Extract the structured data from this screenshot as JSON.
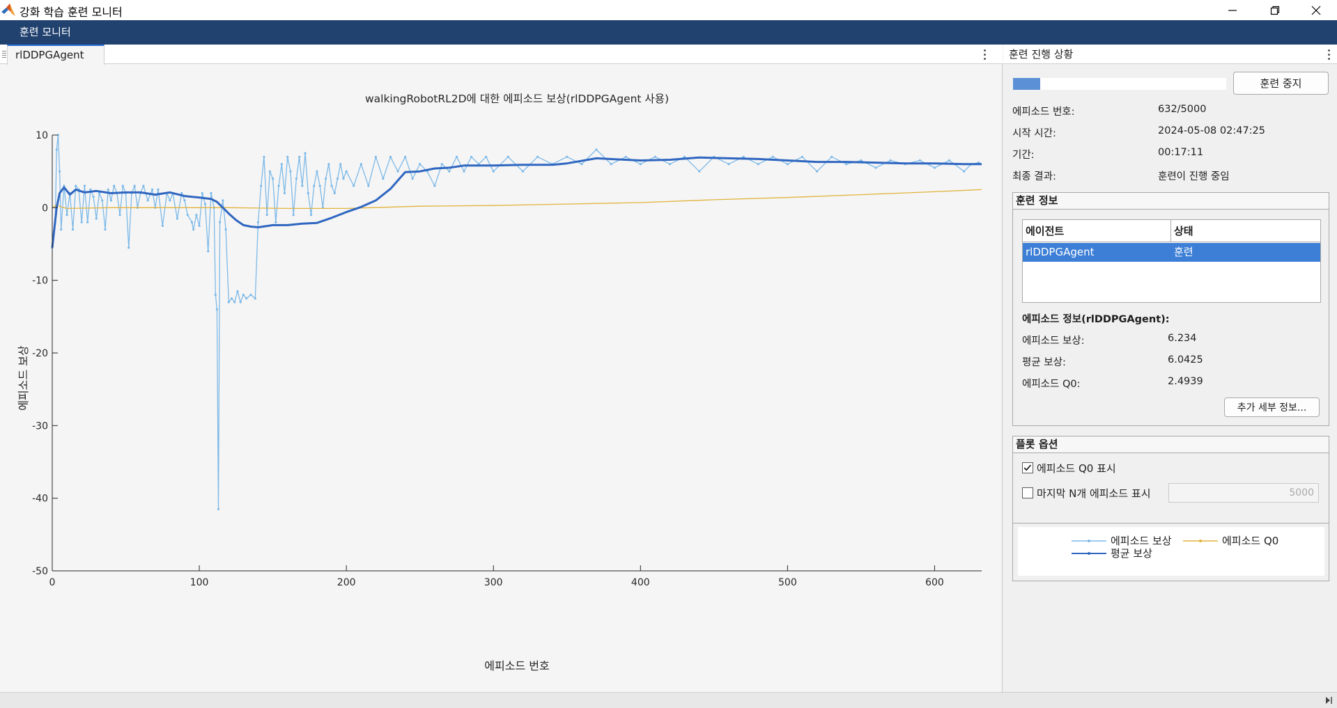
{
  "window": {
    "title": "강화 학습 훈련 모니터",
    "app_tab": "훈련 모니터"
  },
  "document": {
    "tab_label": "rlDDPGAgent"
  },
  "chart_data": {
    "type": "line",
    "title": "walkingRobotRL2D에 대한 에피소드 보상(rlDDPGAgent 사용)",
    "xlabel": "에피소드 번호",
    "ylabel": "에피소드 보상",
    "xlim": [
      0,
      632
    ],
    "ylim": [
      -50,
      10
    ],
    "xticks": [
      "0",
      "100",
      "200",
      "300",
      "400",
      "500",
      "600"
    ],
    "yticks": [
      "10",
      "0",
      "-10",
      "-20",
      "-30",
      "-40",
      "-50"
    ],
    "series": [
      {
        "name": "에피소드 보상",
        "color": "#7db9e8",
        "points": [
          [
            0,
            -5.5
          ],
          [
            2,
            -2
          ],
          [
            3,
            8
          ],
          [
            4,
            10
          ],
          [
            5,
            5
          ],
          [
            6,
            -3
          ],
          [
            8,
            3
          ],
          [
            10,
            -1
          ],
          [
            12,
            2
          ],
          [
            14,
            -3
          ],
          [
            16,
            3
          ],
          [
            18,
            2.5
          ],
          [
            20,
            -2
          ],
          [
            22,
            3
          ],
          [
            24,
            -2
          ],
          [
            26,
            2.5
          ],
          [
            28,
            1.5
          ],
          [
            30,
            -1.5
          ],
          [
            32,
            2
          ],
          [
            34,
            1
          ],
          [
            36,
            -3
          ],
          [
            38,
            2.5
          ],
          [
            40,
            1
          ],
          [
            42,
            3
          ],
          [
            44,
            2
          ],
          [
            46,
            -1
          ],
          [
            48,
            3
          ],
          [
            50,
            2
          ],
          [
            52,
            -5.5
          ],
          [
            54,
            2
          ],
          [
            56,
            3
          ],
          [
            58,
            0
          ],
          [
            60,
            2
          ],
          [
            62,
            3
          ],
          [
            65,
            1
          ],
          [
            68,
            2.5
          ],
          [
            70,
            0
          ],
          [
            72,
            2.5
          ],
          [
            75,
            -2.5
          ],
          [
            78,
            2
          ],
          [
            80,
            1
          ],
          [
            82,
            2
          ],
          [
            85,
            -1.5
          ],
          [
            88,
            2
          ],
          [
            90,
            1
          ],
          [
            92,
            -1
          ],
          [
            95,
            -2
          ],
          [
            96,
            -3
          ],
          [
            98,
            -1
          ],
          [
            100,
            -2.5
          ],
          [
            102,
            2
          ],
          [
            104,
            0.5
          ],
          [
            106,
            -6
          ],
          [
            108,
            2
          ],
          [
            110,
            0
          ],
          [
            111,
            -12
          ],
          [
            112,
            -14
          ],
          [
            113,
            -41.5
          ],
          [
            114,
            -2
          ],
          [
            116,
            1
          ],
          [
            118,
            -3
          ],
          [
            120,
            -13
          ],
          [
            122,
            -12.5
          ],
          [
            124,
            -13
          ],
          [
            126,
            -11.5
          ],
          [
            128,
            -13
          ],
          [
            130,
            -12
          ],
          [
            132,
            -12.5
          ],
          [
            135,
            -12
          ],
          [
            138,
            -12.5
          ],
          [
            140,
            -2
          ],
          [
            142,
            3
          ],
          [
            144,
            7
          ],
          [
            146,
            -1
          ],
          [
            148,
            5
          ],
          [
            150,
            4
          ],
          [
            152,
            -2
          ],
          [
            154,
            3
          ],
          [
            156,
            6
          ],
          [
            158,
            2
          ],
          [
            160,
            7
          ],
          [
            162,
            5
          ],
          [
            164,
            -1
          ],
          [
            166,
            4
          ],
          [
            168,
            7
          ],
          [
            170,
            3
          ],
          [
            172,
            7.5
          ],
          [
            174,
            2
          ],
          [
            176,
            -1
          ],
          [
            178,
            3
          ],
          [
            180,
            5
          ],
          [
            182,
            3
          ],
          [
            184,
            0
          ],
          [
            186,
            4
          ],
          [
            188,
            6
          ],
          [
            190,
            3
          ],
          [
            192,
            2
          ],
          [
            194,
            4
          ],
          [
            196,
            6
          ],
          [
            198,
            4
          ],
          [
            200,
            5
          ],
          [
            205,
            3
          ],
          [
            210,
            6
          ],
          [
            215,
            3
          ],
          [
            220,
            7
          ],
          [
            225,
            4
          ],
          [
            230,
            7
          ],
          [
            235,
            5
          ],
          [
            240,
            7
          ],
          [
            245,
            4
          ],
          [
            250,
            6
          ],
          [
            255,
            5
          ],
          [
            260,
            3
          ],
          [
            265,
            6
          ],
          [
            270,
            5
          ],
          [
            275,
            7
          ],
          [
            280,
            5
          ],
          [
            285,
            7
          ],
          [
            290,
            6
          ],
          [
            295,
            7
          ],
          [
            300,
            5
          ],
          [
            310,
            7
          ],
          [
            320,
            5
          ],
          [
            330,
            7
          ],
          [
            340,
            6
          ],
          [
            350,
            7
          ],
          [
            360,
            6
          ],
          [
            370,
            8
          ],
          [
            380,
            6
          ],
          [
            390,
            7
          ],
          [
            400,
            6
          ],
          [
            410,
            7
          ],
          [
            420,
            6
          ],
          [
            430,
            7
          ],
          [
            440,
            5
          ],
          [
            450,
            7
          ],
          [
            460,
            6
          ],
          [
            470,
            7
          ],
          [
            480,
            6
          ],
          [
            490,
            7
          ],
          [
            500,
            6
          ],
          [
            510,
            7
          ],
          [
            520,
            5
          ],
          [
            530,
            7
          ],
          [
            540,
            6
          ],
          [
            550,
            6.5
          ],
          [
            560,
            5.5
          ],
          [
            570,
            6.5
          ],
          [
            580,
            6
          ],
          [
            590,
            6.5
          ],
          [
            600,
            5.5
          ],
          [
            610,
            6.5
          ],
          [
            620,
            5
          ],
          [
            625,
            6
          ],
          [
            630,
            6.2
          ]
        ]
      },
      {
        "name": "평균 보상",
        "color": "#2f66c0",
        "points": [
          [
            0,
            -5.5
          ],
          [
            3,
            0
          ],
          [
            5,
            2
          ],
          [
            8,
            2.8
          ],
          [
            12,
            1.8
          ],
          [
            16,
            2.5
          ],
          [
            22,
            2.1
          ],
          [
            30,
            2.3
          ],
          [
            40,
            2
          ],
          [
            50,
            2.1
          ],
          [
            60,
            2.1
          ],
          [
            70,
            1.8
          ],
          [
            80,
            2.1
          ],
          [
            90,
            1.6
          ],
          [
            100,
            1.4
          ],
          [
            108,
            1.2
          ],
          [
            112,
            0.8
          ],
          [
            115,
            0.2
          ],
          [
            120,
            -0.8
          ],
          [
            125,
            -1.7
          ],
          [
            130,
            -2.4
          ],
          [
            135,
            -2.6
          ],
          [
            140,
            -2.7
          ],
          [
            150,
            -2.4
          ],
          [
            160,
            -2.4
          ],
          [
            170,
            -2.2
          ],
          [
            180,
            -2.1
          ],
          [
            190,
            -1.4
          ],
          [
            200,
            -0.6
          ],
          [
            210,
            0.1
          ],
          [
            220,
            1
          ],
          [
            230,
            2.6
          ],
          [
            240,
            4.9
          ],
          [
            250,
            5
          ],
          [
            260,
            5.4
          ],
          [
            270,
            5.5
          ],
          [
            280,
            5.8
          ],
          [
            300,
            5.8
          ],
          [
            320,
            5.9
          ],
          [
            340,
            5.9
          ],
          [
            350,
            6.1
          ],
          [
            370,
            6.8
          ],
          [
            390,
            6.6
          ],
          [
            400,
            6.5
          ],
          [
            420,
            6.6
          ],
          [
            440,
            6.9
          ],
          [
            460,
            6.8
          ],
          [
            480,
            6.7
          ],
          [
            500,
            6.5
          ],
          [
            520,
            6.3
          ],
          [
            540,
            6.3
          ],
          [
            560,
            6.2
          ],
          [
            580,
            6.1
          ],
          [
            600,
            6.1
          ],
          [
            620,
            6
          ],
          [
            632,
            6
          ]
        ]
      },
      {
        "name": "에피소드 Q0",
        "color": "#e2b33c",
        "points": [
          [
            0,
            0
          ],
          [
            3,
            0.4
          ],
          [
            6,
            0.1
          ],
          [
            10,
            -0.1
          ],
          [
            40,
            0
          ],
          [
            80,
            0
          ],
          [
            120,
            0
          ],
          [
            160,
            -0.1
          ],
          [
            200,
            -0.1
          ],
          [
            250,
            0.2
          ],
          [
            300,
            0.3
          ],
          [
            350,
            0.5
          ],
          [
            400,
            0.7
          ],
          [
            450,
            1.1
          ],
          [
            500,
            1.4
          ],
          [
            550,
            1.8
          ],
          [
            600,
            2.2
          ],
          [
            632,
            2.5
          ]
        ]
      }
    ],
    "grid": false,
    "legend": "bottom-right panel"
  },
  "progress": {
    "header": "훈련 진행 상황",
    "fraction": 0.1264,
    "stop_button": "훈련 중지",
    "rows": [
      {
        "label": "에피소드 번호:",
        "value": "632/5000"
      },
      {
        "label": "시작 시간:",
        "value": "2024-05-08 02:47:25"
      },
      {
        "label": "기간:",
        "value": "00:17:11"
      },
      {
        "label": "최종 결과:",
        "value": "훈련이 진행 중임"
      }
    ]
  },
  "training_info": {
    "title": "훈련 정보",
    "col_agent": "에이전트",
    "col_status": "상태",
    "row_agent": "rlDDPGAgent",
    "row_status": "훈련",
    "episode_title": "에피소드 정보(rlDDPGAgent):",
    "episode_rows": [
      {
        "label": "에피소드 보상:",
        "value": "6.234"
      },
      {
        "label": "평균 보상:",
        "value": "6.0425"
      },
      {
        "label": "에피소드 Q0:",
        "value": "2.4939"
      }
    ],
    "more_button": "추가 세부 정보..."
  },
  "plot_options": {
    "title": "플롯 옵션",
    "show_q0_label": "에피소드 Q0 표시",
    "show_q0_checked": true,
    "last_n_label": "마지막 N개 에피소드 표시",
    "last_n_checked": false,
    "last_n_value": "5000"
  },
  "legend": {
    "episode_reward": "에피소드 보상",
    "episode_q0": "에피소드 Q0",
    "avg_reward": "평균 보상"
  }
}
